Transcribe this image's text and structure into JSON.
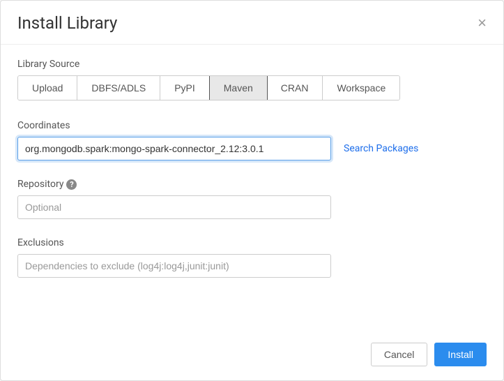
{
  "modal": {
    "title": "Install Library"
  },
  "librarySource": {
    "label": "Library Source",
    "tabs": [
      {
        "label": "Upload"
      },
      {
        "label": "DBFS/ADLS"
      },
      {
        "label": "PyPI"
      },
      {
        "label": "Maven"
      },
      {
        "label": "CRAN"
      },
      {
        "label": "Workspace"
      }
    ]
  },
  "coordinates": {
    "label": "Coordinates",
    "value": "org.mongodb.spark:mongo-spark-connector_2.12:3.0.1",
    "searchLink": "Search Packages"
  },
  "repository": {
    "label": "Repository",
    "placeholder": "Optional"
  },
  "exclusions": {
    "label": "Exclusions",
    "placeholder": "Dependencies to exclude (log4j:log4j,junit:junit)"
  },
  "footer": {
    "cancel": "Cancel",
    "install": "Install"
  }
}
